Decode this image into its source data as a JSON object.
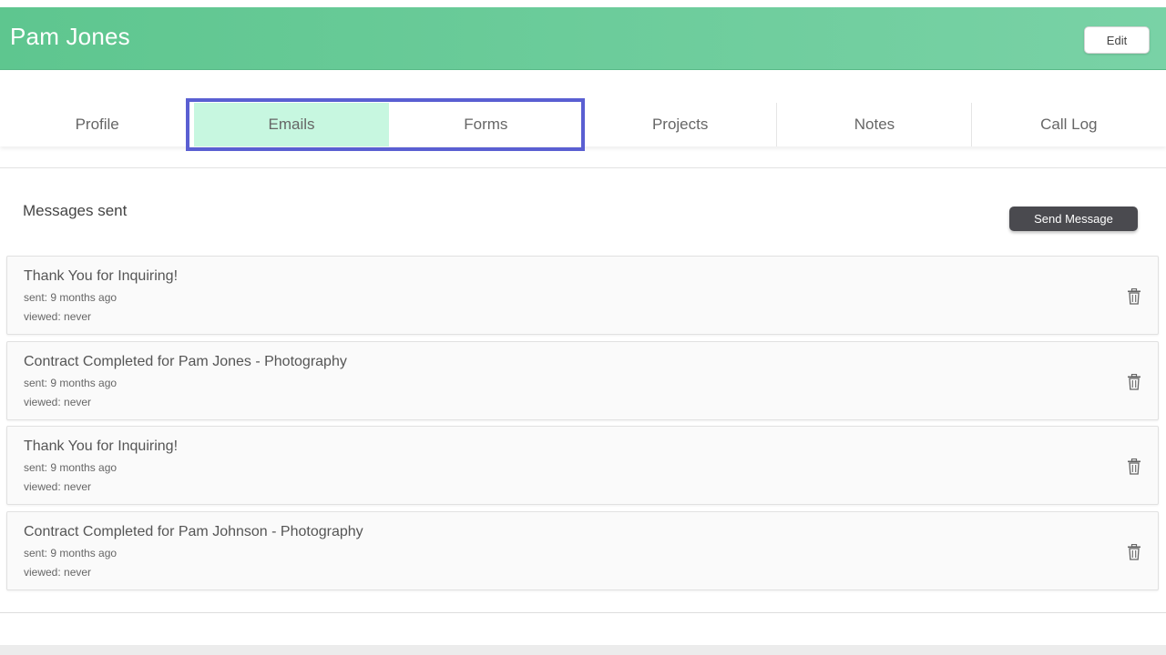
{
  "header": {
    "title": "Pam Jones",
    "edit_label": "Edit",
    "color_start": "#5ec68f",
    "color_end": "#79d2a6"
  },
  "tabs": [
    {
      "label": "Profile",
      "active": false
    },
    {
      "label": "Emails",
      "active": true
    },
    {
      "label": "Forms",
      "active": false
    },
    {
      "label": "Projects",
      "active": false
    },
    {
      "label": "Notes",
      "active": false
    },
    {
      "label": "Call Log",
      "active": false
    }
  ],
  "highlight_color": "#5a5fd2",
  "messages": {
    "title": "Messages sent",
    "send_label": "Send Message",
    "items": [
      {
        "title": "Thank You for Inquiring!",
        "sent": "sent: 9 months ago",
        "viewed": "viewed: never",
        "icon": "trash-icon"
      },
      {
        "title": "Contract Completed for Pam Jones - Photography",
        "sent": "sent: 9 months ago",
        "viewed": "viewed: never",
        "icon": "trash-icon"
      },
      {
        "title": "Thank You for Inquiring!",
        "sent": "sent: 9 months ago",
        "viewed": "viewed: never",
        "icon": "trash-icon"
      },
      {
        "title": "Contract Completed for Pam Johnson - Photography",
        "sent": "sent: 9 months ago",
        "viewed": "viewed: never",
        "icon": "trash-icon"
      }
    ]
  }
}
